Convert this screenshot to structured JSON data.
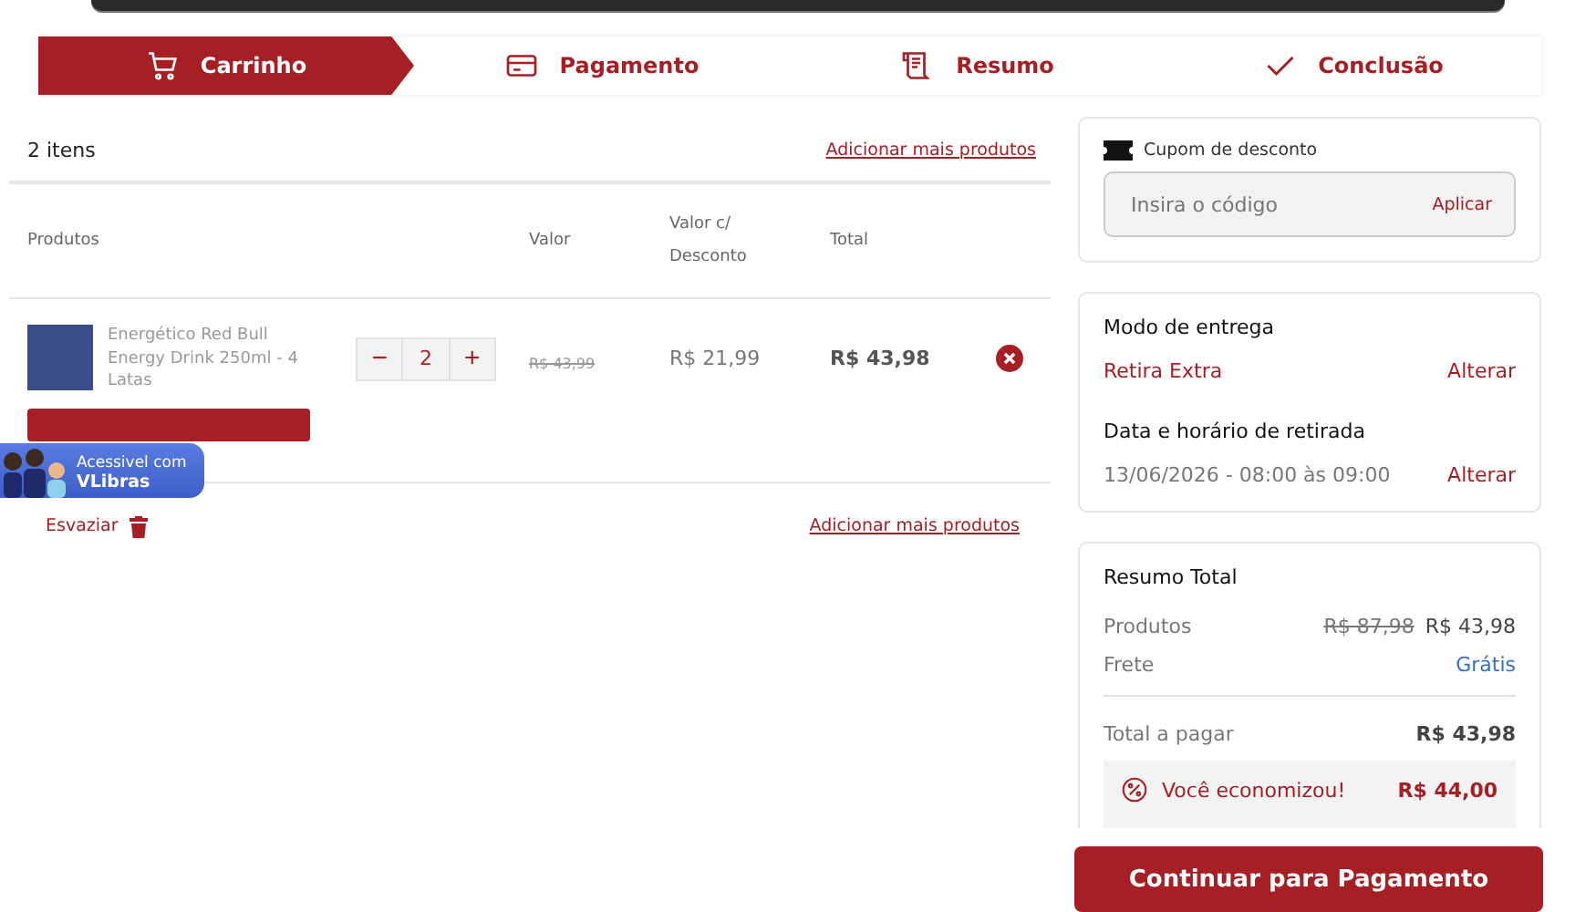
{
  "steps": [
    {
      "label": "Carrinho",
      "kind": "cart",
      "selected": true
    },
    {
      "label": "Pagamento",
      "kind": "payment",
      "selected": false
    },
    {
      "label": "Resumo",
      "kind": "review",
      "selected": false
    },
    {
      "label": "Conclusão",
      "kind": "done",
      "selected": false
    }
  ],
  "cart": {
    "count": "2 itens",
    "add_link": "Adicionar mais produtos",
    "columns": [
      "Produtos",
      "Valor",
      "Valor c/\nDesconto",
      "Total"
    ],
    "items": [
      {
        "name": "Energético Red Bull Energy Drink 250ml - 4 Latas",
        "quantity": "2",
        "minus": "−",
        "plus": "+",
        "price": "R$ 43,99",
        "discount_price": "R$ 21,99",
        "total": "R$ 43,98"
      }
    ],
    "empty_label": "Esvaziar",
    "add_link_bottom": "Adicionar mais produtos"
  },
  "accessibility_widget": {
    "line1": "Acessivel com",
    "line2": "VLibras"
  },
  "coupon": {
    "title": "Cupom de desconto",
    "placeholder": "Insira o código",
    "apply": "Aplicar"
  },
  "delivery": {
    "title": "Modo de entrega",
    "mode": "Retira Extra",
    "change": "Alterar",
    "date_title": "Data e horário de retirada",
    "date": "13/06/2026 - 08:00 às 09:00",
    "date_change": "Alterar"
  },
  "summary": {
    "title": "Resumo Total",
    "products_label": "Produtos",
    "products_old": "R$ 87,98",
    "products_value": "R$ 43,98",
    "shipping_label": "Frete",
    "shipping_value": "Grátis",
    "total_label": "Total a pagar",
    "total_value": "R$ 43,98",
    "savings_label": "Você economizou!",
    "savings_value": "R$ 44,00"
  },
  "continue_button": "Continuar para Pagamento"
}
